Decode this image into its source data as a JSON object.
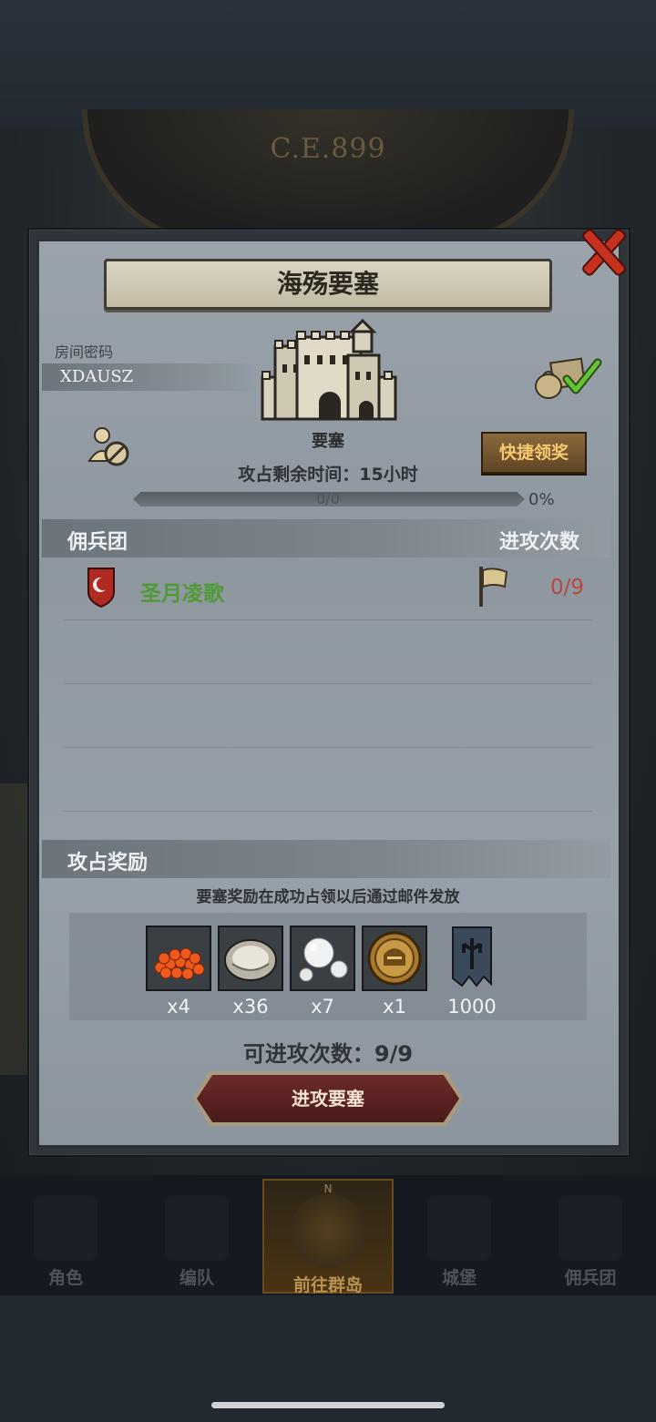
{
  "background": {
    "era_text": "C.E.899"
  },
  "panel": {
    "title": "海殇要塞",
    "room": {
      "label": "房间密码",
      "code": "XDAUSZ"
    },
    "fortress": {
      "label": "要塞"
    },
    "quick_claim_label": "快捷领奖",
    "remaining_time_text": "攻占剩余时间：15小时",
    "progress": {
      "text": "0/0",
      "percent_label": "0%",
      "fraction": 0
    },
    "mercenary_section": {
      "title": "佣兵团",
      "attack_count_header": "进攻次数",
      "rows": [
        {
          "name": "圣月凌歌",
          "attacks": "0/9"
        }
      ]
    },
    "reward_section": {
      "title": "攻占奖励",
      "note": "要塞奖励在成功占领以后通过邮件发放",
      "items": [
        {
          "icon": "salmon-roe-icon",
          "qty": "x4"
        },
        {
          "icon": "oyster-icon",
          "qty": "x36"
        },
        {
          "icon": "pearl-icon",
          "qty": "x7"
        },
        {
          "icon": "knight-helmet-coin-icon",
          "qty": "x1"
        },
        {
          "icon": "war-banner-icon",
          "qty": "1000"
        }
      ]
    },
    "attempts_text": "可进攻次数：9/9",
    "attack_button_label": "进攻要塞"
  },
  "bottom_nav": {
    "items": [
      {
        "label": "角色",
        "icon": "knight-icon"
      },
      {
        "label": "编队",
        "icon": "helmet-icon"
      },
      {
        "label": "前往群岛",
        "icon": "compass-icon",
        "active": true
      },
      {
        "label": "城堡",
        "icon": "castle-icon"
      },
      {
        "label": "佣兵团",
        "icon": "mercenary-icon"
      }
    ],
    "compass_letter": "N"
  },
  "colors": {
    "accent_gold": "#f7c970",
    "guild_green": "#4f9a34",
    "count_red": "#b8473b",
    "close_red": "#c6301f"
  }
}
